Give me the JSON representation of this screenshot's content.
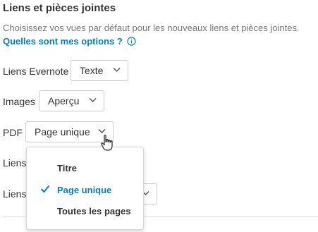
{
  "section": {
    "title": "Liens et pièces jointes",
    "description": "Choisissez vos vues par défaut pour les nouveaux liens et pièces jointes.",
    "options_link": "Quelles sont mes options ?"
  },
  "rows": [
    {
      "label": "Liens Evernote",
      "value": "Texte"
    },
    {
      "label": "Images",
      "value": "Aperçu"
    },
    {
      "label": "PDF",
      "value": "Page unique"
    },
    {
      "label": "Liens"
    },
    {
      "label": "Liens"
    }
  ],
  "dropdown": {
    "items": [
      {
        "label": "Titre",
        "selected": false
      },
      {
        "label": "Page unique",
        "selected": true
      },
      {
        "label": "Toutes les pages",
        "selected": false
      }
    ]
  },
  "colors": {
    "accent": "#0081c2",
    "text": "#333333",
    "muted": "#777777",
    "border": "#cccccc"
  },
  "icons": {
    "info": "info-icon",
    "chevron": "chevron-down-icon",
    "check": "check-icon",
    "cursor": "hand-pointer-icon"
  }
}
